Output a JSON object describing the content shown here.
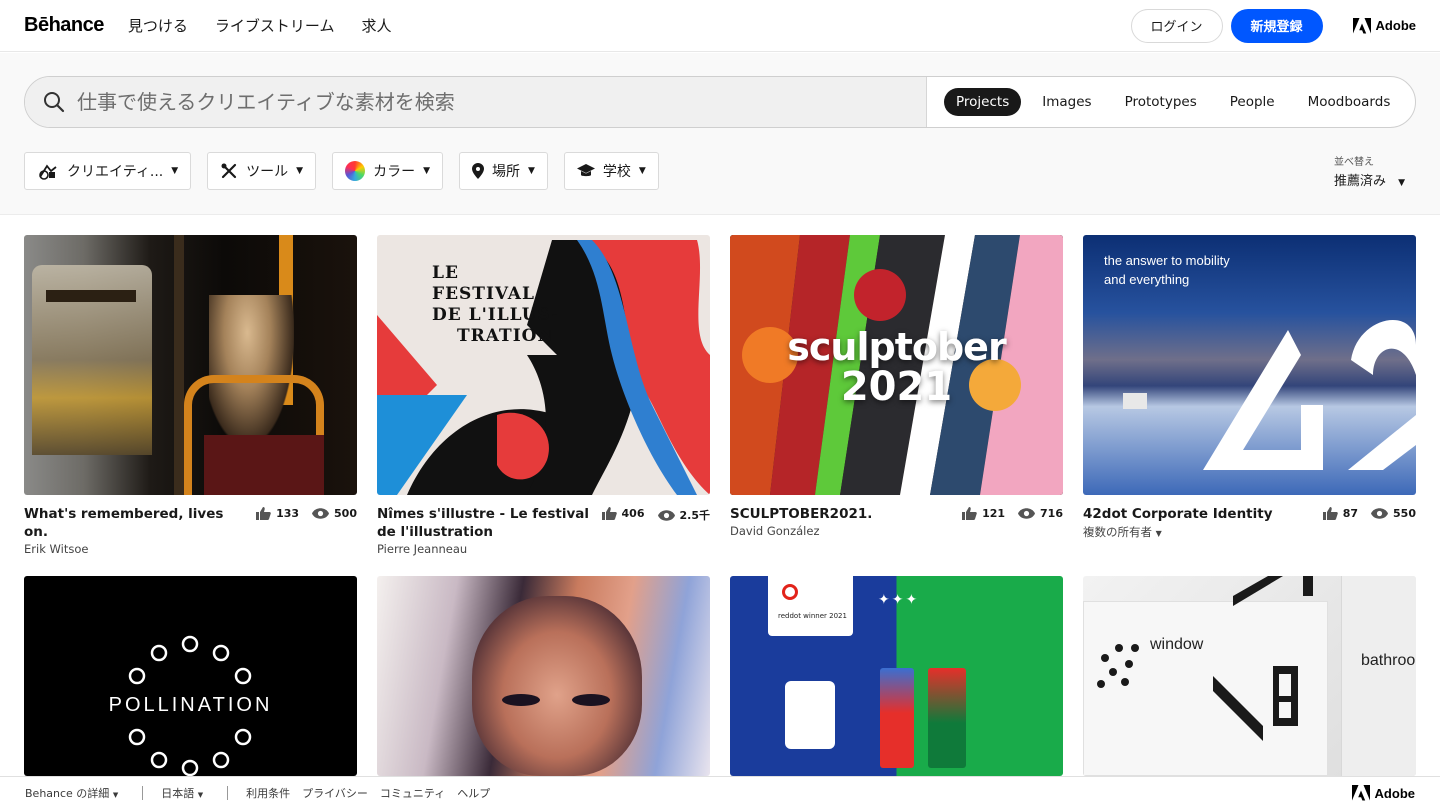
{
  "header": {
    "logo": "Bēhance",
    "nav": [
      "見つける",
      "ライブストリーム",
      "求人"
    ],
    "login": "ログイン",
    "signup": "新規登録",
    "adobe": "Adobe"
  },
  "search": {
    "placeholder": "仕事で使えるクリエイティブな素材を検索",
    "tabs": [
      "Projects",
      "Images",
      "Prototypes",
      "People",
      "Moodboards"
    ],
    "active_tab": "Projects"
  },
  "filters": [
    "クリエイティ...",
    "ツール",
    "カラー",
    "場所",
    "学校"
  ],
  "sort": {
    "label": "並べ替え",
    "value": "推薦済み"
  },
  "projects": [
    {
      "title": "What's remembered, lives on.",
      "owner": "Erik Witsoe",
      "likes": "133",
      "views": "500"
    },
    {
      "title": "Nîmes s'illustre - Le festival de l'illustration",
      "owner": "Pierre Jeanneau",
      "likes": "406",
      "views": "2.5千"
    },
    {
      "title": "SCULPTOBER2021.",
      "owner": "David González",
      "likes": "121",
      "views": "716"
    },
    {
      "title": "42dot Corporate Identity",
      "owner": "複数の所有者",
      "likes": "87",
      "views": "550"
    }
  ],
  "thumb_text": {
    "festival": [
      "LE",
      "FESTIVAL",
      "DE L'ILLUS-",
      "TRATION"
    ],
    "sculptober": [
      "sculptober",
      "2021"
    ],
    "mobility": [
      "the answer to mobility",
      "and everything"
    ],
    "pollination": "POLLINATION",
    "reddot": "reddot winner 2021",
    "window": "window",
    "bathroom": "bathroo"
  },
  "footer": {
    "more": "Behance の詳細",
    "language": "日本語",
    "links": [
      "利用条件",
      "プライバシー",
      "コミュニティ",
      "ヘルプ"
    ],
    "adobe": "Adobe"
  },
  "colors": {
    "accent": "#0057ff",
    "text": "#191919"
  }
}
